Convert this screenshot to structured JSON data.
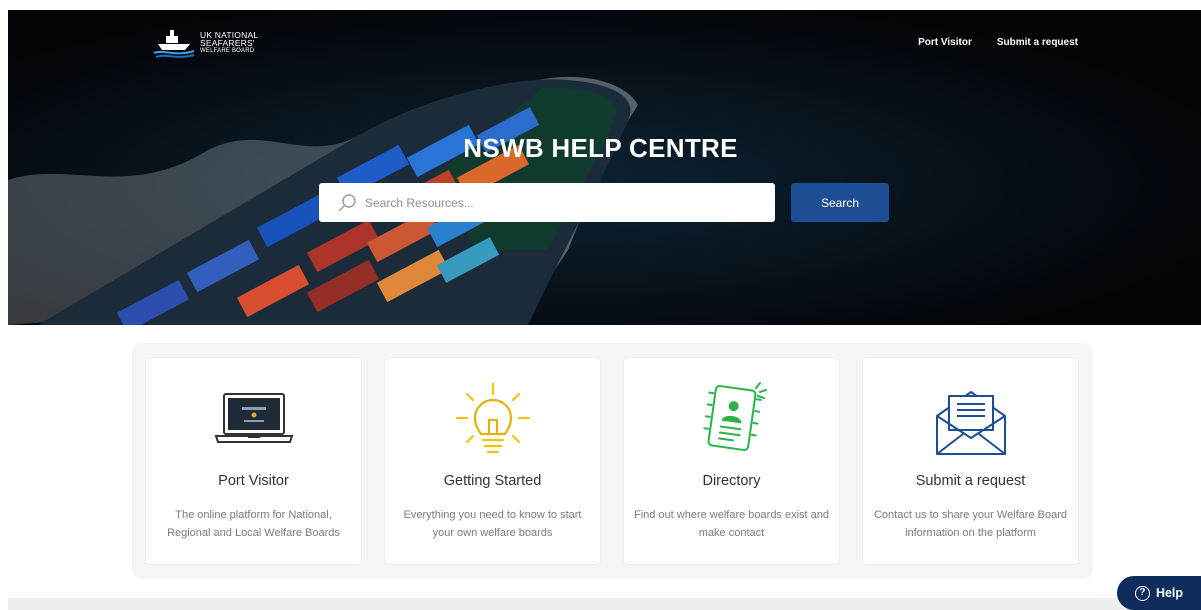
{
  "header": {
    "logo": {
      "line1": "UK NATIONAL",
      "line2": "SEAFARERS'",
      "line3": "WELFARE BOARD"
    },
    "nav": [
      {
        "label": "Port Visitor"
      },
      {
        "label": "Submit a request"
      }
    ]
  },
  "hero": {
    "title": "NSWB HELP CENTRE",
    "search": {
      "placeholder": "Search Resources...",
      "button_label": "Search"
    }
  },
  "cards": [
    {
      "title": "Port Visitor",
      "description": "The online platform for National, Regional and Local Welfare Boards",
      "icon": "laptop-icon"
    },
    {
      "title": "Getting Started",
      "description": "Everything you need to know to start your own welfare boards",
      "icon": "lightbulb-icon"
    },
    {
      "title": "Directory",
      "description": "Find out where welfare boards exist and make contact",
      "icon": "address-book-icon"
    },
    {
      "title": "Submit a request",
      "description": "Contact us to share your Welfare Board information on the platform",
      "icon": "envelope-icon"
    }
  ],
  "help_widget": {
    "label": "Help"
  },
  "colors": {
    "primary": "#1d4e94",
    "help": "#0e2d5c",
    "bulb": "#f2c40e",
    "directory": "#2bb24c"
  }
}
